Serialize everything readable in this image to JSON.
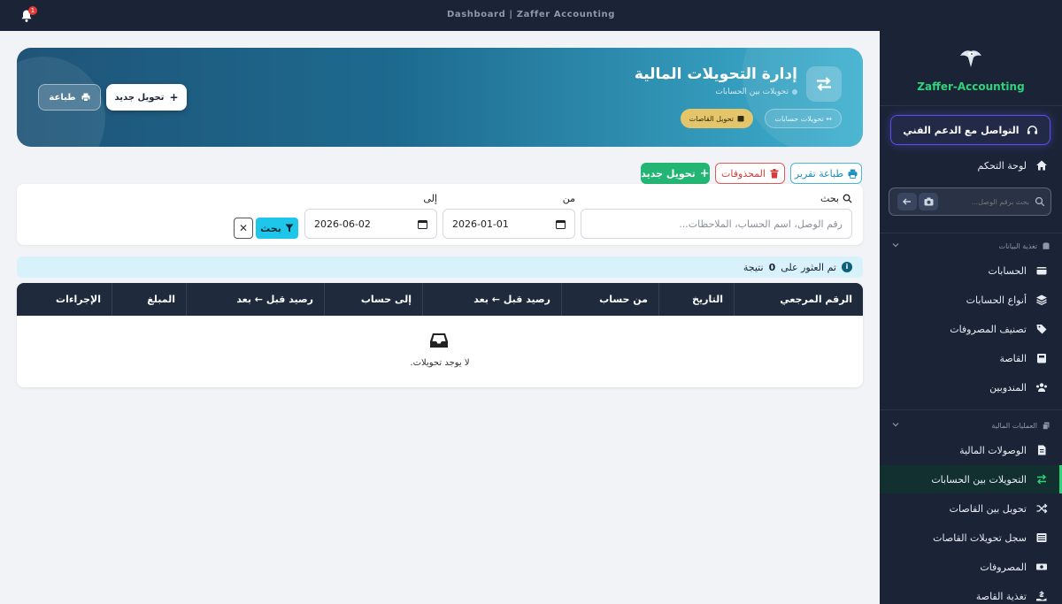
{
  "topbar": {
    "title": "Dashboard | Zaffer Accounting",
    "notification_count": "1"
  },
  "sidebar": {
    "brand": "Zaffer-Accounting",
    "support_label": "التواصل مع الدعم الفني",
    "dashboard_label": "لوحة التحكم",
    "search_placeholder": "بحث برقم الوصل...",
    "sections": [
      {
        "label": "تغذية البيانات",
        "items": [
          "الحسابات",
          "أنواع الحسابات",
          "تصنيف المصروفات",
          "القاصة",
          "المندوبين"
        ]
      },
      {
        "label": "العمليات المالية",
        "items": [
          "الوصولات المالية",
          "التحويلات بين الحسابات",
          "تحويل بين القاصات",
          "سجل تحويلات القاصات",
          "المصروفات",
          "تغذية القاصة"
        ]
      }
    ],
    "active_item": "التحويلات بين الحسابات"
  },
  "hero": {
    "title": "إدارة التحويلات المالية",
    "subtitle": "تحويلات بين الحسابات",
    "chip_accounts": "↔ تحويلات حسابات",
    "chip_cashboxes": "تحويل القاصات",
    "new_button": "تحويل جديد",
    "print_button": "طباعة"
  },
  "actions": {
    "print_report": "طباعة تقرير",
    "deleted": "المحذوفات",
    "new_transfer": "تحويل جديد"
  },
  "filters": {
    "search_label": "بحث",
    "search_placeholder": "رقم الوصل، اسم الحساب، الملاحظات...",
    "from_label": "من",
    "from_value": "2026-01-01",
    "to_label": "إلى",
    "to_value": "2026-06-02",
    "search_button": "بحث",
    "clear_button": "✕"
  },
  "results": {
    "prefix": "تم العثور على",
    "count": "0",
    "suffix": "نتيجة"
  },
  "table": {
    "columns": [
      "الرقم المرجعي",
      "التاريخ",
      "من حساب",
      "رصيد قبل ← بعد",
      "إلى حساب",
      "رصيد قبل ← بعد",
      "المبلغ",
      "الإجراءات"
    ],
    "empty_text": "لا يوجد تحويلات."
  },
  "colors": {
    "accent_green": "#2ed47a",
    "sidebar_bg": "#1b2436",
    "danger": "#e05a5a",
    "info": "#1ec6ea"
  }
}
